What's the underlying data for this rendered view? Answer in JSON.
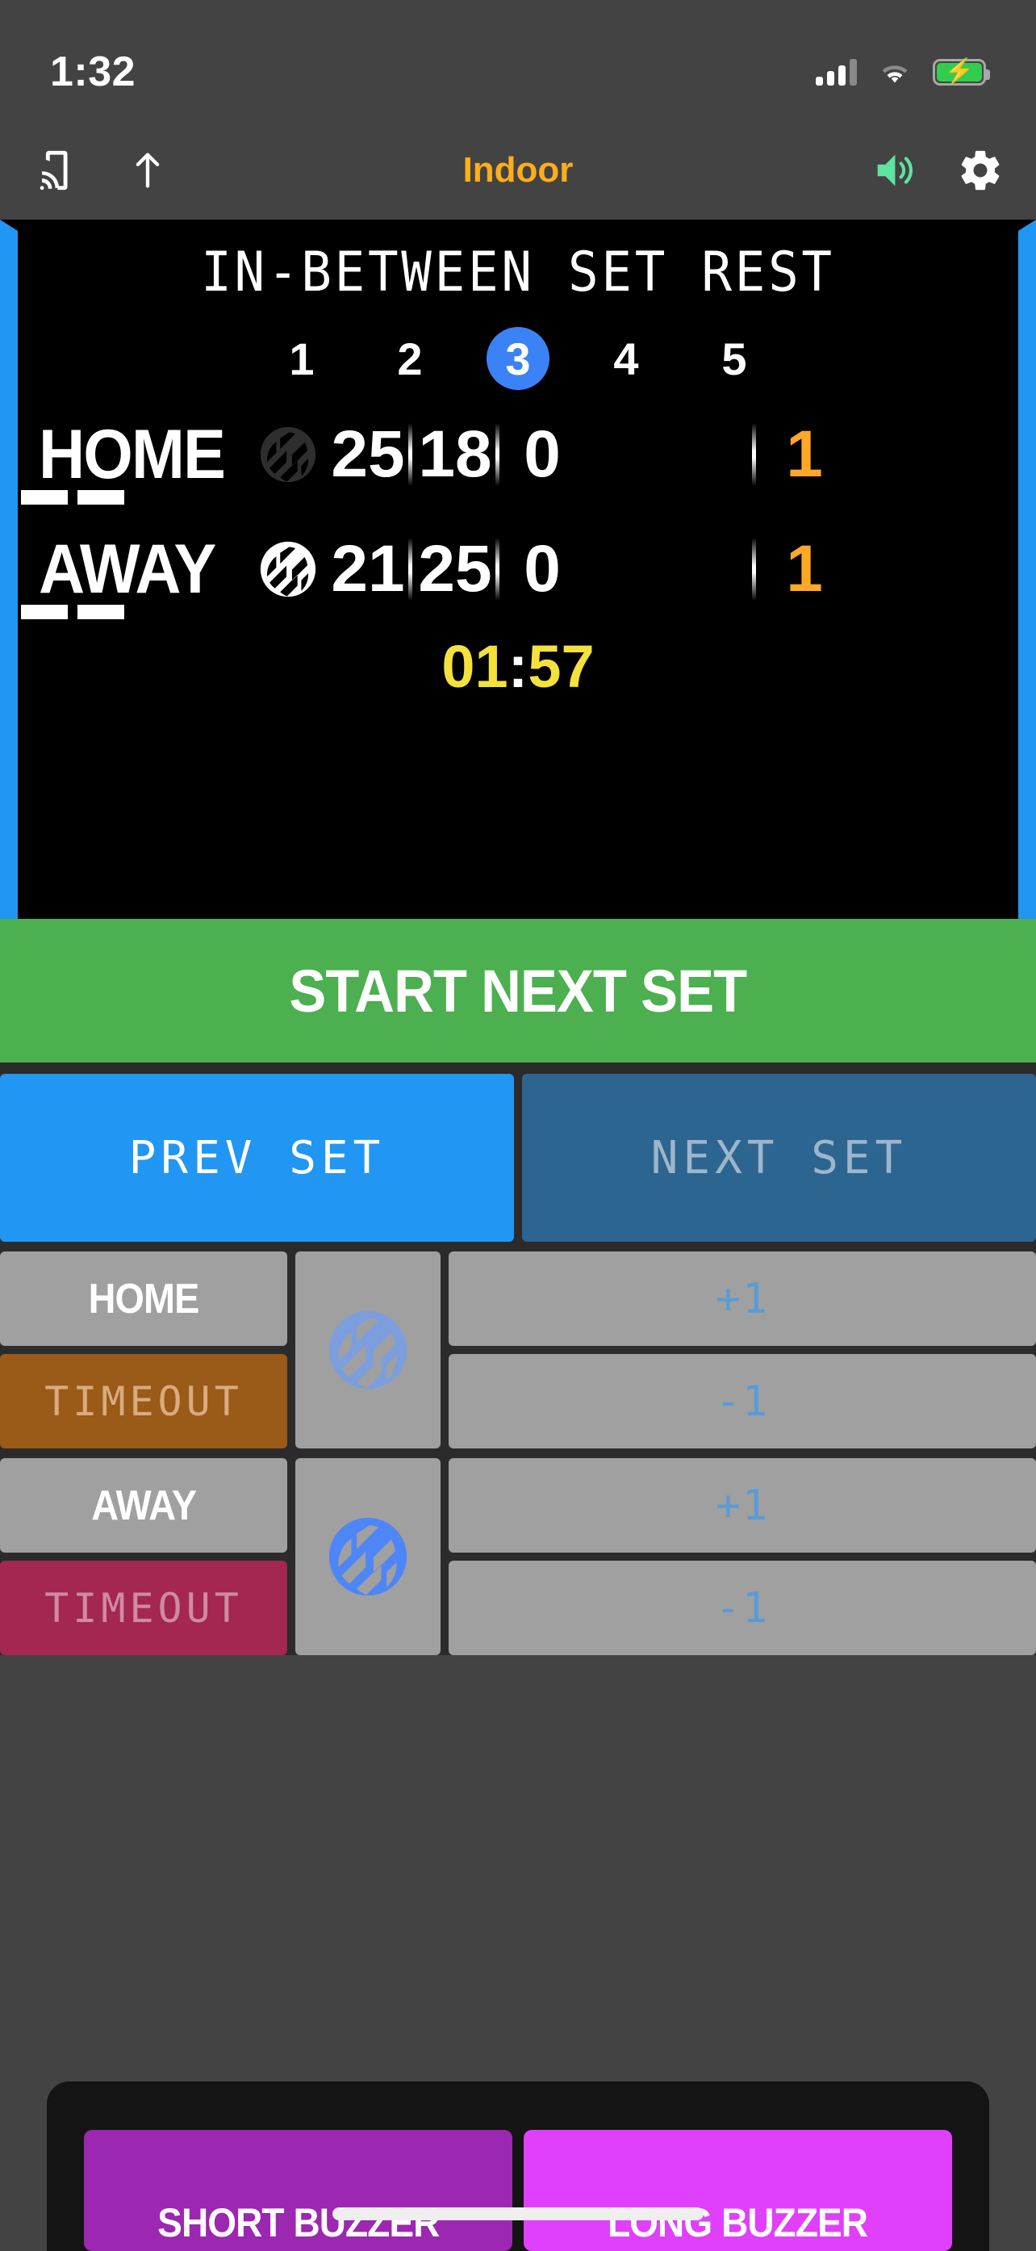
{
  "status_bar": {
    "time": "1:32",
    "signal_icon": "cellular-signal-icon",
    "wifi_icon": "wifi-icon",
    "battery_icon": "battery-charging-icon",
    "battery_color": "#32cd4e"
  },
  "app_bar": {
    "title": "Indoor",
    "title_color": "#FFAE1A",
    "cast_icon": "cast-icon",
    "share_icon": "share-up-arrow-icon",
    "volume_icon": "speaker-volume-icon",
    "volume_color": "#5fe3a1",
    "settings_icon": "gear-icon"
  },
  "scoreboard": {
    "status_text": "IN-BETWEEN SET REST",
    "accent_color": "#2196f3",
    "sets": [
      "1",
      "2",
      "3",
      "4",
      "5"
    ],
    "active_set": "3",
    "teams": [
      {
        "name": "HOME",
        "serving": false,
        "ball_icon": "volleyball-icon",
        "set_scores": [
          "25",
          "18",
          "0",
          "",
          "",
          ""
        ],
        "sets_won": "1",
        "timeouts_used": 2
      },
      {
        "name": "AWAY",
        "serving": true,
        "ball_icon": "volleyball-icon",
        "set_scores": [
          "21",
          "25",
          "0",
          "",
          "",
          ""
        ],
        "sets_won": "1",
        "timeouts_used": 2
      }
    ],
    "timer_minutes": "01",
    "timer_separator": ":",
    "timer_seconds": "57",
    "timer_color": "#F5E13C"
  },
  "actions": {
    "start_next_set": "START NEXT SET",
    "start_next_set_color": "#4CAF50",
    "prev_set": "PREV SET",
    "next_set": "NEXT SET",
    "prev_set_enabled": true,
    "next_set_enabled": false
  },
  "controls": {
    "home": {
      "name_label": "HOME",
      "timeout_label": "TIMEOUT",
      "timeout_color": "#9a5a18",
      "serve_icon": "volleyball-icon",
      "serve_active": false,
      "plus_label": "+1",
      "minus_label": "-1"
    },
    "away": {
      "name_label": "AWAY",
      "timeout_label": "TIMEOUT",
      "timeout_color": "#a32751",
      "serve_icon": "volleyball-icon",
      "serve_active": true,
      "plus_label": "+1",
      "minus_label": "-1"
    }
  },
  "buzzers": {
    "short_label": "SHORT BUZZER",
    "short_color": "#9c27b0",
    "long_label": "LONG BUZZER",
    "long_color": "#e040fb"
  }
}
